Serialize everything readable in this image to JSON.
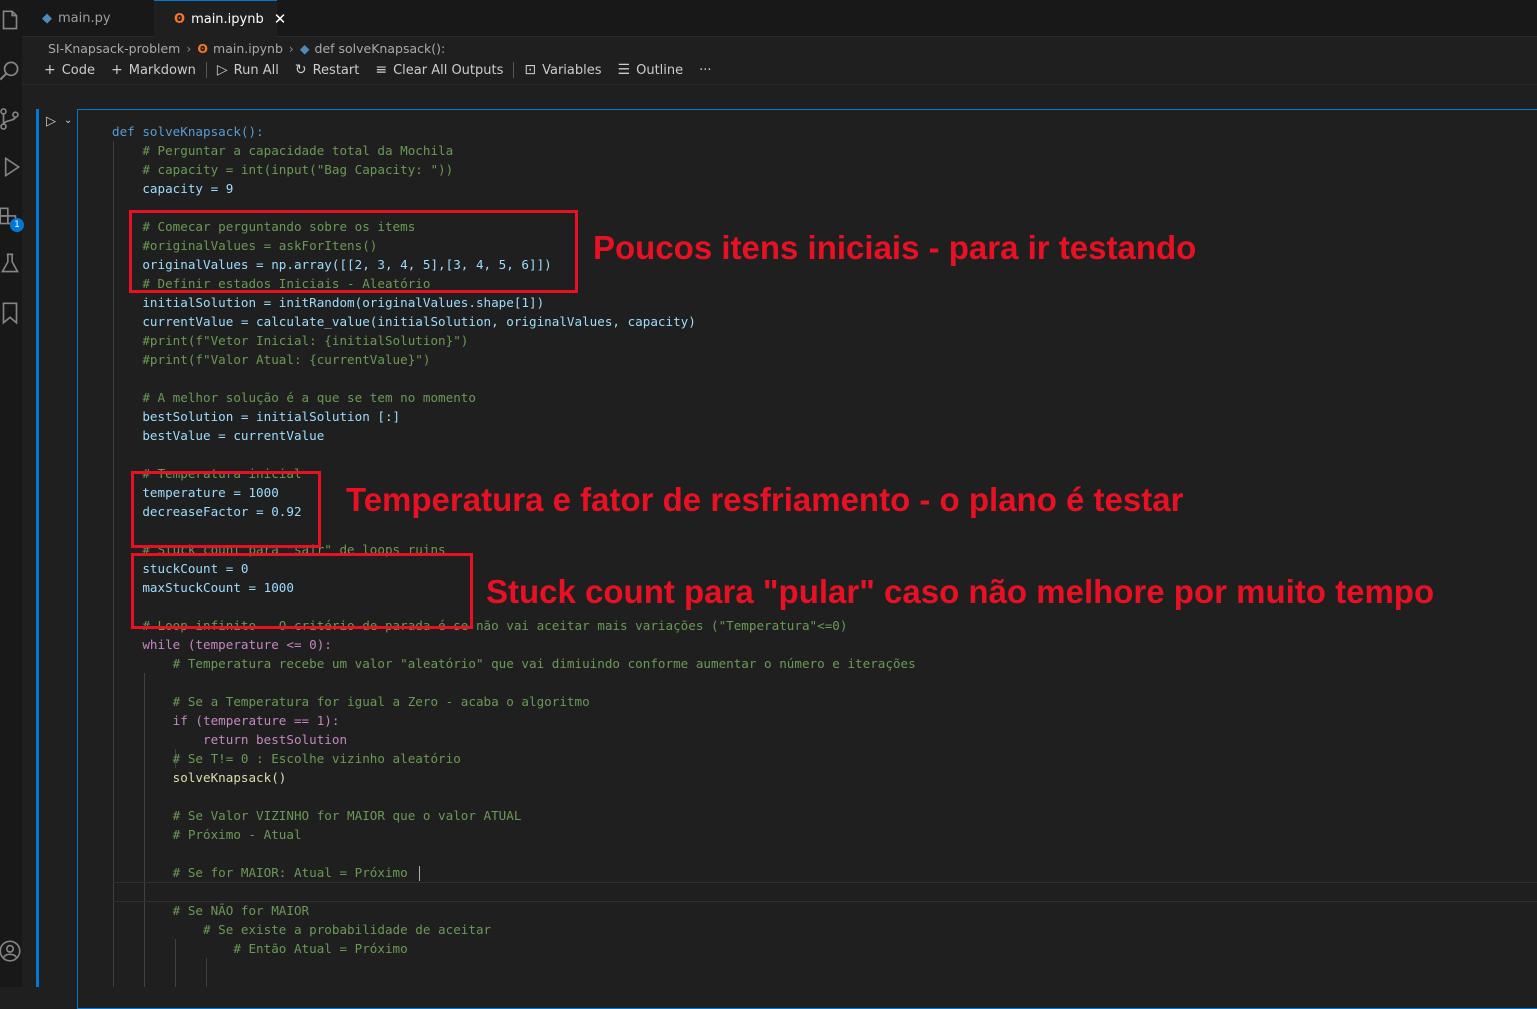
{
  "tabs": [
    {
      "label": "main.py",
      "icon": "python-icon",
      "active": false
    },
    {
      "label": "main.ipynb",
      "icon": "notebook-icon",
      "active": true
    }
  ],
  "breadcrumb": [
    "SI-Knapsack-problem",
    "main.ipynb",
    "def solveKnapsack():"
  ],
  "toolbar": {
    "code": "Code",
    "markdown": "Markdown",
    "run_all": "Run All",
    "restart": "Restart",
    "clear_outputs": "Clear All Outputs",
    "variables": "Variables",
    "outline": "Outline",
    "more": "···"
  },
  "activity_bar": {
    "icons": [
      "files-icon",
      "search-icon",
      "source-control-icon",
      "run-debug-icon",
      "extensions-icon",
      "testing-icon",
      "bookmarks-icon",
      "account-icon"
    ],
    "extensions_badge": "1"
  },
  "annotations": {
    "a1": "Poucos itens iniciais - para ir testando",
    "a2": "Temperatura e fator de resfriamento - o plano é testar",
    "a3": "Stuck count para \"pular\" caso não melhore por muito tempo"
  },
  "code_lines": [
    "def solveKnapsack():",
    "    # Perguntar a capacidade total da Mochila",
    "    # capacity = int(input(\"Bag Capacity: \"))",
    "    capacity = 9",
    "",
    "    # Comecar perguntando sobre os items",
    "    #originalValues = askForItens()",
    "    originalValues = np.array([[2, 3, 4, 5],[3, 4, 5, 6]])",
    "    # Definir estados Iniciais - Aleatório",
    "    initialSolution = initRandom(originalValues.shape[1])",
    "    currentValue = calculate_value(initialSolution, originalValues, capacity)",
    "    #print(f\"Vetor Inicial: {initialSolution}\")",
    "    #print(f\"Valor Atual: {currentValue}\")",
    "",
    "    # A melhor solução é a que se tem no momento",
    "    bestSolution = initialSolution [:]",
    "    bestValue = currentValue",
    "",
    "    # Temperatura inicial",
    "    temperature = 1000",
    "    decreaseFactor = 0.92",
    "",
    "    # Stuck count para \"sair\" de loops ruins",
    "    stuckCount = 0",
    "    maxStuckCount = 1000",
    "",
    "    # Loop infinito - O critério de parada é se não vai aceitar mais variações (\"Temperatura\"<=0)",
    "    while (temperature <= 0):",
    "        # Temperatura recebe um valor \"aleatório\" que vai dimiuindo conforme aumentar o número e iterações",
    "",
    "        # Se a Temperatura for igual a Zero - acaba o algoritmo",
    "        if (temperature == 1):",
    "            return bestSolution",
    "        # Se T!= 0 : Escolhe vizinho aleatório",
    "        solveKnapsack()",
    "",
    "        # Se Valor VIZINHO for MAIOR que o valor ATUAL",
    "        # Próximo - Atual",
    "",
    "        # Se for MAIOR: Atual = Próximo ",
    "",
    "        # Se NÃO for MAIOR",
    "            # Se existe a probabilidade de aceitar",
    "                # Então Atual = Próximo"
  ]
}
